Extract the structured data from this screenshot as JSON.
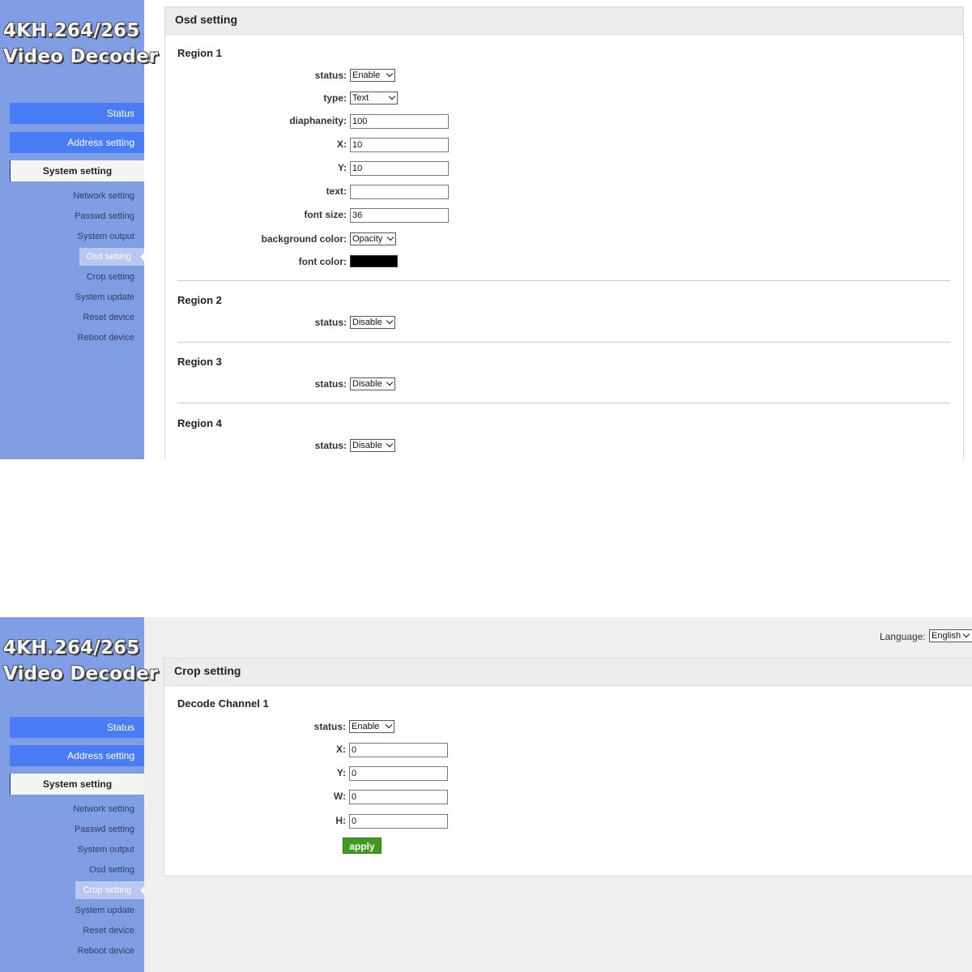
{
  "logo": {
    "line1": "4KH.264/265",
    "line2": "Video Decoder"
  },
  "top": {
    "nav": {
      "status": "Status",
      "address": "Address setting",
      "system": "System setting"
    },
    "sub": [
      "Network setting",
      "Passwd setting",
      "System output",
      "Osd setting",
      "Crop setting",
      "System update",
      "Reset device",
      "Reboot device"
    ],
    "selected_sub": "Osd setting",
    "panel_title": "Osd setting",
    "region1": {
      "title": "Region 1",
      "status_label": "status:",
      "status_value": "Enable",
      "type_label": "type:",
      "type_value": "Text",
      "diaphaneity_label": "diaphaneity:",
      "diaphaneity_value": "100",
      "x_label": "X:",
      "x_value": "10",
      "y_label": "Y:",
      "y_value": "10",
      "text_label": "text:",
      "text_value": "",
      "fontsize_label": "font size:",
      "fontsize_value": "36",
      "bg_label": "background color:",
      "bg_value": "Opacity",
      "fontcolor_label": "font color:",
      "fontcolor_hex": "#000000"
    },
    "region2": {
      "title": "Region 2",
      "status_label": "status:",
      "status_value": "Disable"
    },
    "region3": {
      "title": "Region 3",
      "status_label": "status:",
      "status_value": "Disable"
    },
    "region4": {
      "title": "Region 4",
      "status_label": "status:",
      "status_value": "Disable"
    }
  },
  "bottom": {
    "language_label": "Language:",
    "language_value": "English",
    "nav": {
      "status": "Status",
      "address": "Address setting",
      "system": "System setting"
    },
    "sub": [
      "Network setting",
      "Passwd setting",
      "System output",
      "Osd setting",
      "Crop setting",
      "System update",
      "Reset device",
      "Reboot device"
    ],
    "selected_sub": "Crop setting",
    "panel_title": "Crop setting",
    "channel": {
      "title": "Decode Channel 1",
      "status_label": "status:",
      "status_value": "Enable",
      "x_label": "X:",
      "x_value": "0",
      "y_label": "Y:",
      "y_value": "0",
      "w_label": "W:",
      "w_value": "0",
      "h_label": "H:",
      "h_value": "0",
      "apply": "apply"
    }
  },
  "colors": {
    "sidebar": "#7f9ee6",
    "nav_button": "#4a7df5",
    "apply_button": "#3f9a1f"
  }
}
